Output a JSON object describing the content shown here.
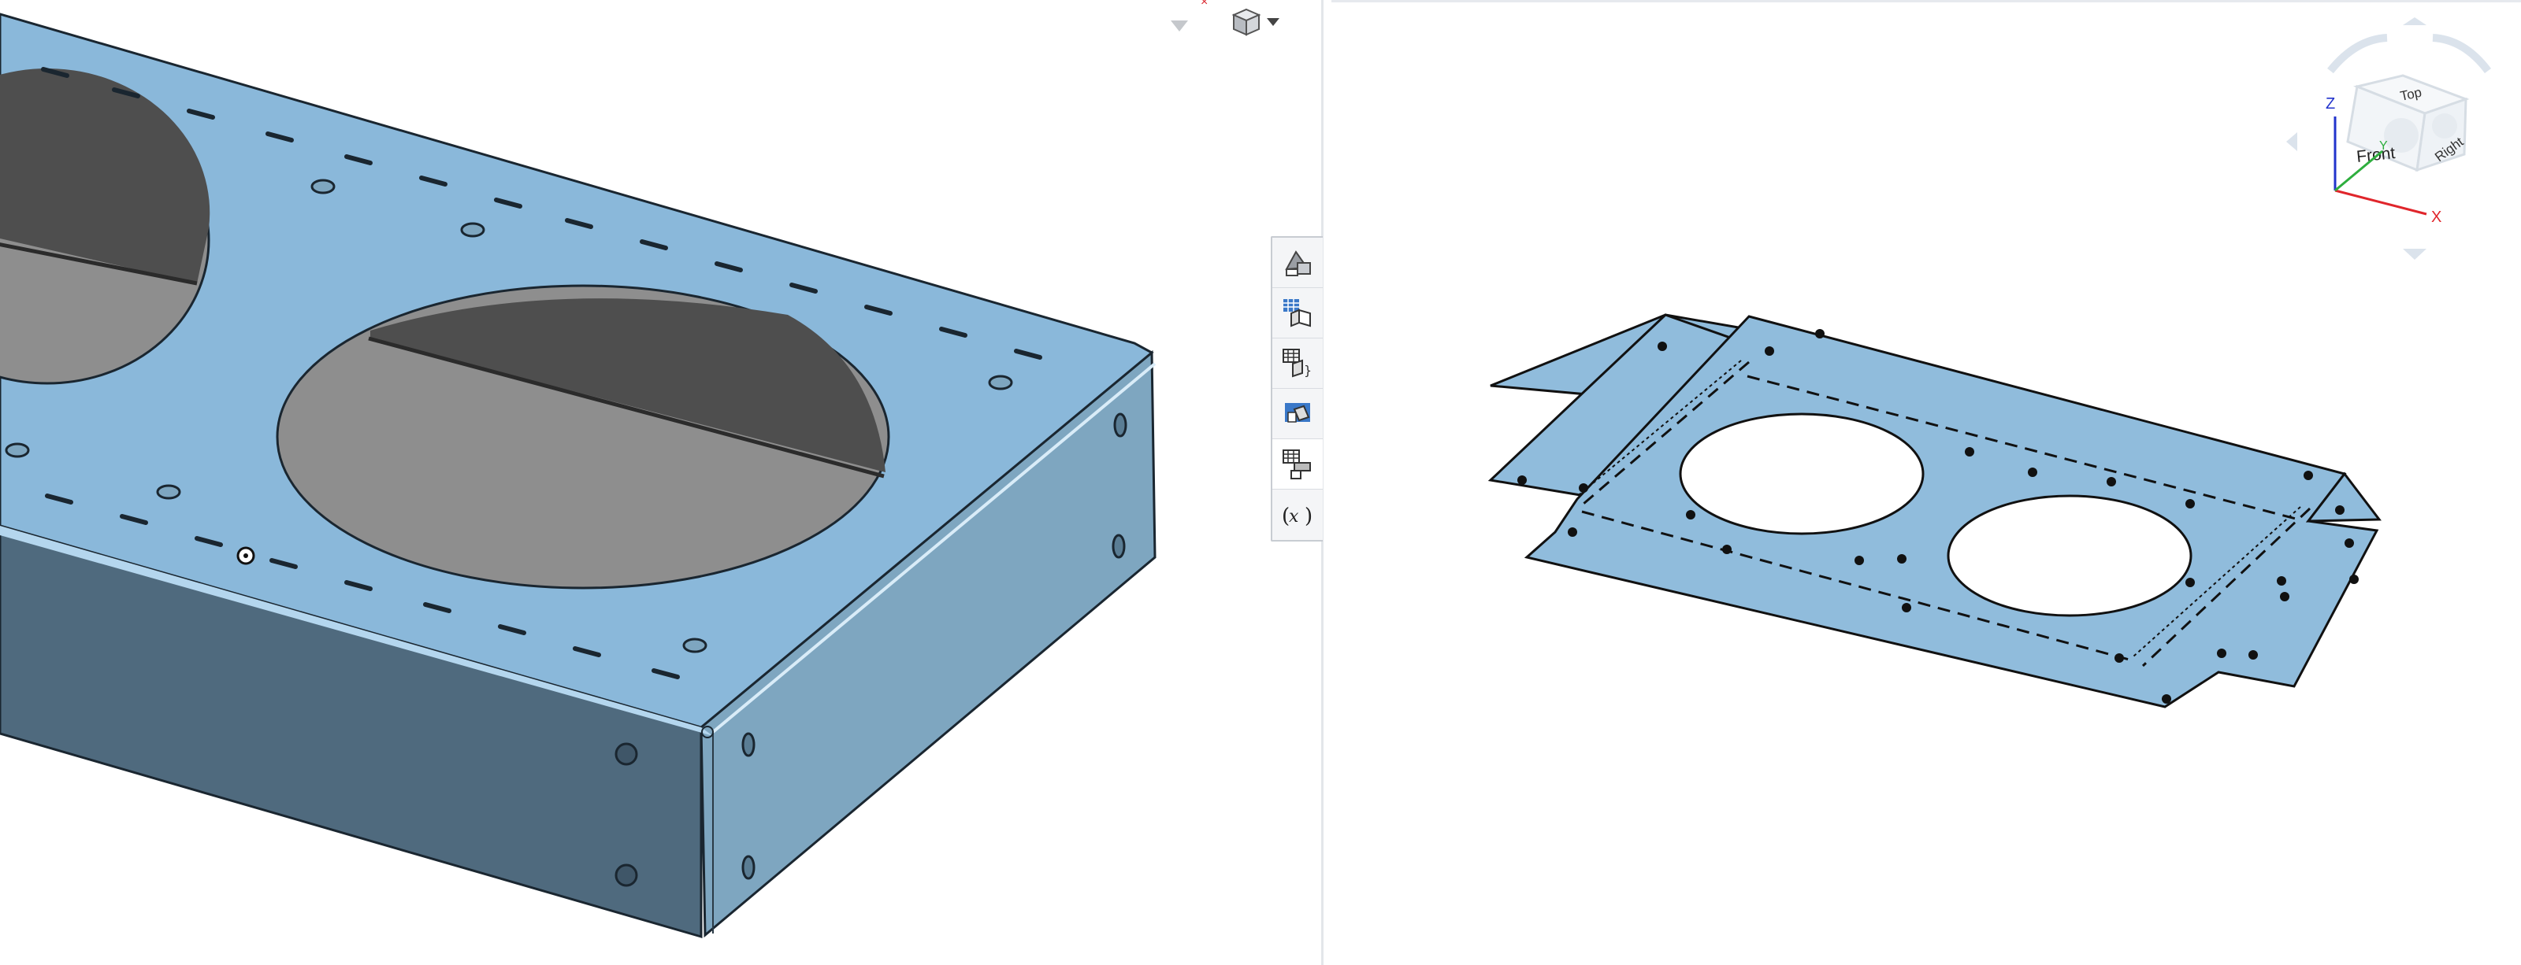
{
  "left_view": {
    "part": "sheet-metal-enclosure-3d",
    "view_cube_icon": "cube-icon",
    "dropdown_icon": "chevron-down-icon"
  },
  "toolbar": {
    "items": [
      {
        "name": "appearance-tool",
        "icon": "appearance-icon"
      },
      {
        "name": "table-view-tool",
        "icon": "table-cube-icon"
      },
      {
        "name": "part-properties-tool",
        "icon": "properties-icon"
      },
      {
        "name": "display-states-tool",
        "icon": "display-states-icon"
      },
      {
        "name": "sheet-metal-table-tool",
        "icon": "flat-table-icon"
      },
      {
        "name": "variables-tool",
        "icon": "variables-icon"
      }
    ]
  },
  "right_view": {
    "part": "sheet-metal-flat-pattern"
  },
  "navcube": {
    "faces": {
      "top": "Top",
      "front": "Front",
      "right": "Right"
    },
    "axes": {
      "x": "X",
      "y": "Y",
      "z": "Z"
    },
    "colors": {
      "x": "#e0252b",
      "y": "#2eae3e",
      "z": "#2233cc"
    }
  },
  "colors": {
    "part_top": "#8ab8da",
    "part_front": "#4f6a7e",
    "part_side": "#7ea6c0",
    "hole_inner_dark": "#4e4e4e",
    "hole_inner_light": "#8e8e8e",
    "flat_pattern": "#90bcdc"
  }
}
